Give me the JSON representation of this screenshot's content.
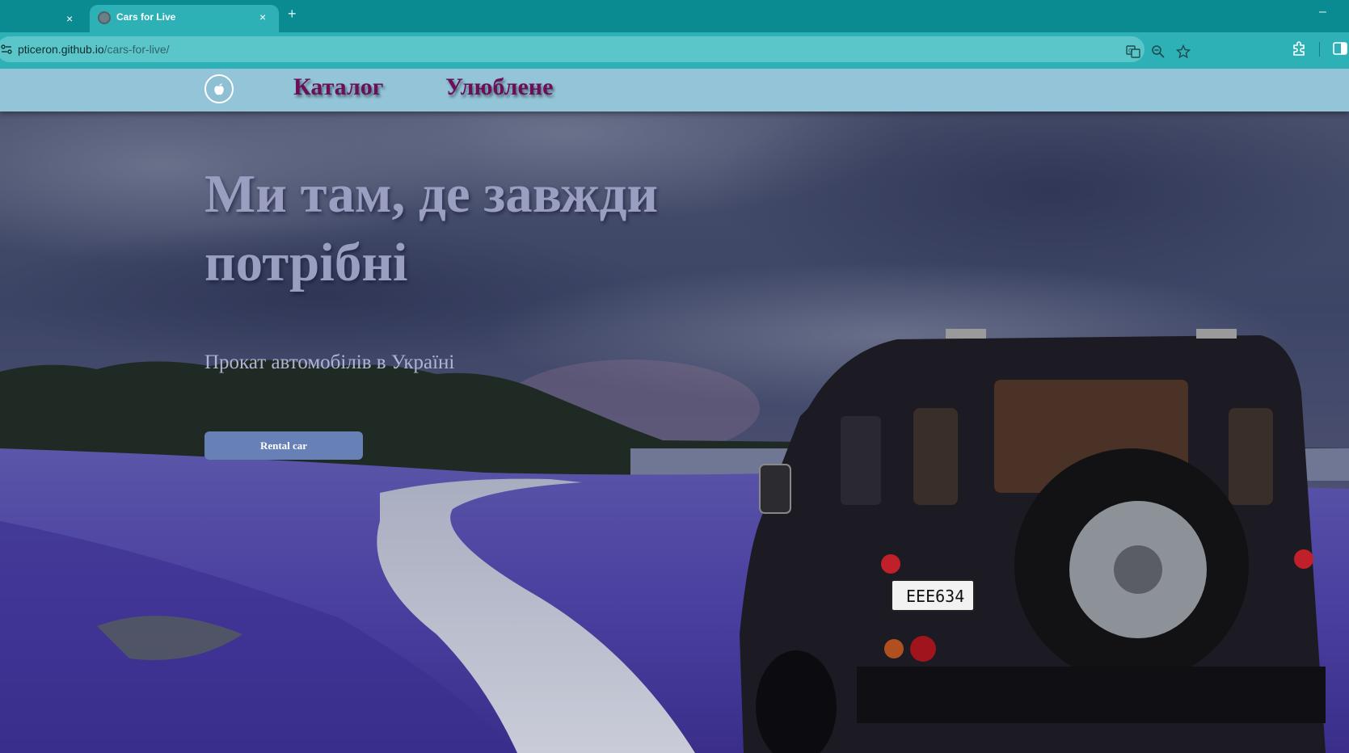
{
  "browser": {
    "tabs": [
      {
        "title": "",
        "close": "×"
      },
      {
        "title": "Cars for Live",
        "close": "×"
      }
    ],
    "new_tab": "+",
    "minimize": "–",
    "url_host": "pticeron.github.io",
    "url_path": "/cars-for-live/",
    "icons": [
      "site-info-icon",
      "translate-icon",
      "zoom-icon",
      "bookmark-star-icon",
      "extensions-icon",
      "side-panel-icon"
    ]
  },
  "site": {
    "nav": {
      "logo_icon": "apple-icon",
      "catalog": "Каталог",
      "favorites": "Улюблене"
    },
    "hero": {
      "title": "Ми там, де завжди потрібні",
      "subtitle": "Прокат автомобілів в Україні",
      "cta": "Rental car"
    },
    "plate": "EEE634",
    "colors": {
      "chrome_tabstrip": "#0a8a91",
      "chrome_toolbar": "#2db1b6",
      "header_bg": "#93c4d8",
      "nav_text": "#6d0e5a",
      "hero_title": "#9a9fc2",
      "button_bg": "#6780b6"
    }
  }
}
